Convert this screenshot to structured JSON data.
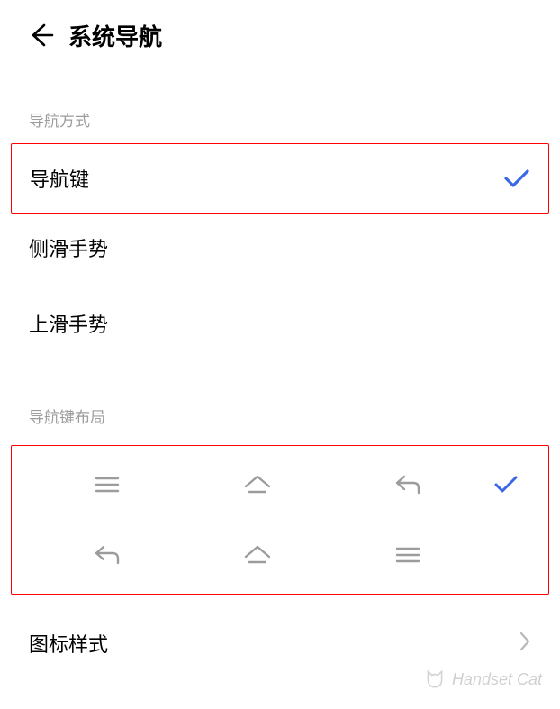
{
  "header": {
    "title": "系统导航"
  },
  "sections": {
    "nav_method_label": "导航方式",
    "nav_layout_label": "导航键布局"
  },
  "nav_options": {
    "keys": "导航键",
    "side_swipe": "侧滑手势",
    "up_swipe": "上滑手势"
  },
  "icon_style": {
    "label": "图标样式"
  },
  "watermark": {
    "text": "Handset Cat"
  },
  "colors": {
    "accent": "#3a66e8",
    "icon_gray": "#9c9c9c",
    "highlight_border": "#ff0000"
  }
}
